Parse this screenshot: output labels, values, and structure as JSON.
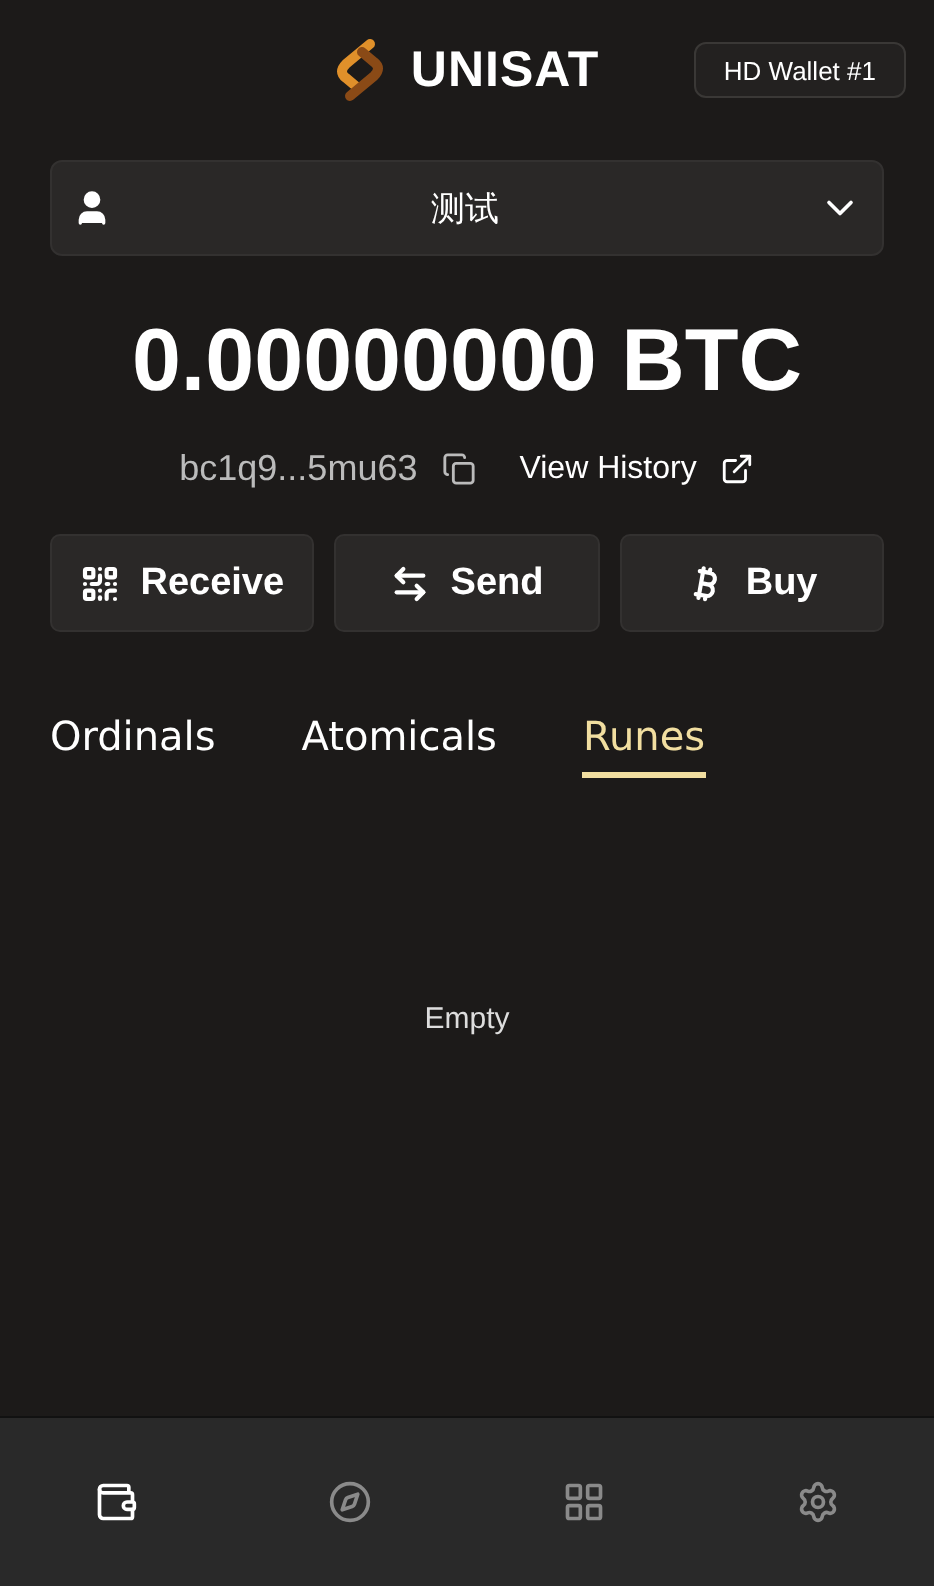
{
  "header": {
    "brand": "UNISAT",
    "wallet_button": "HD Wallet #1"
  },
  "account": {
    "name": "测试"
  },
  "balance": "0.00000000 BTC",
  "address": {
    "text": "bc1q9...5mu63",
    "history_link": "View History"
  },
  "actions": [
    {
      "kind": "receive",
      "label": "Receive"
    },
    {
      "kind": "send",
      "label": "Send"
    },
    {
      "kind": "buy",
      "label": "Buy"
    }
  ],
  "tabs": [
    {
      "label": "Ordinals",
      "selected": false
    },
    {
      "label": "Atomicals",
      "selected": false
    },
    {
      "label": "Runes",
      "selected": true
    }
  ],
  "empty_text": "Empty",
  "nav": [
    {
      "kind": "wallet",
      "selected": true
    },
    {
      "kind": "discover",
      "selected": false
    },
    {
      "kind": "apps",
      "selected": false
    },
    {
      "kind": "settings",
      "selected": false
    }
  ]
}
